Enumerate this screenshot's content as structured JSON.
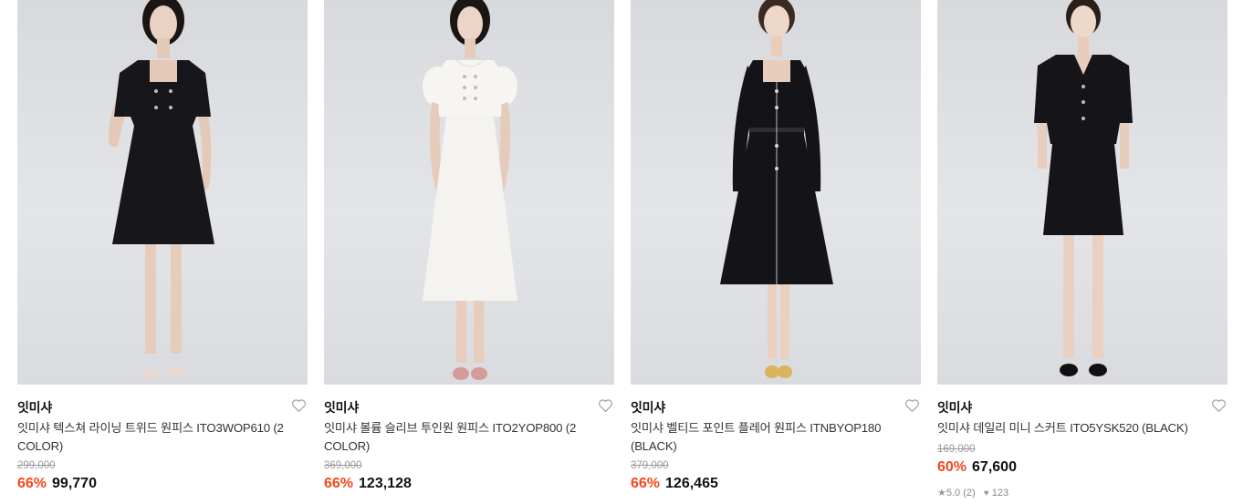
{
  "products": [
    {
      "brand": "잇미샤",
      "name": "잇미샤 텍스쳐 라이닝 트위드 원피스 ITO3WOP610 (2 COLOR)",
      "original_price": "299,000",
      "discount": "66%",
      "price": "99,770",
      "dress_color": "#17171b",
      "image_desc": "black tweed short-sleeve dress"
    },
    {
      "brand": "잇미샤",
      "name": "잇미샤 볼륨 슬리브 투인원 원피스 ITO2YOP800 (2 COLOR)",
      "original_price": "369,000",
      "discount": "66%",
      "price": "123,128",
      "dress_color": "#f4f3ef",
      "image_desc": "white puff-sleeve two-in-one dress"
    },
    {
      "brand": "잇미샤",
      "name": "잇미샤 벨티드 포인트 플레어 원피스 ITNBYOP180 (BLACK)",
      "original_price": "379,000",
      "discount": "66%",
      "price": "126,465",
      "dress_color": "#141418",
      "image_desc": "black belted long-sleeve flare dress"
    },
    {
      "brand": "잇미샤",
      "name": "잇미샤 데일리 미니 스커트 ITO5YSK520 (BLACK)",
      "original_price": "169,000",
      "discount": "60%",
      "price": "67,600",
      "rating": "5.0 (2)",
      "likes": "123",
      "dress_color": "#151519",
      "image_desc": "black cropped jacket and mini skirt"
    }
  ],
  "icons": {
    "wishlist": "heart-outline-icon",
    "rating": "star-icon",
    "likes": "heart-filled-icon"
  },
  "colors": {
    "discount": "#f2471c",
    "original_price": "#9a9a9a"
  }
}
